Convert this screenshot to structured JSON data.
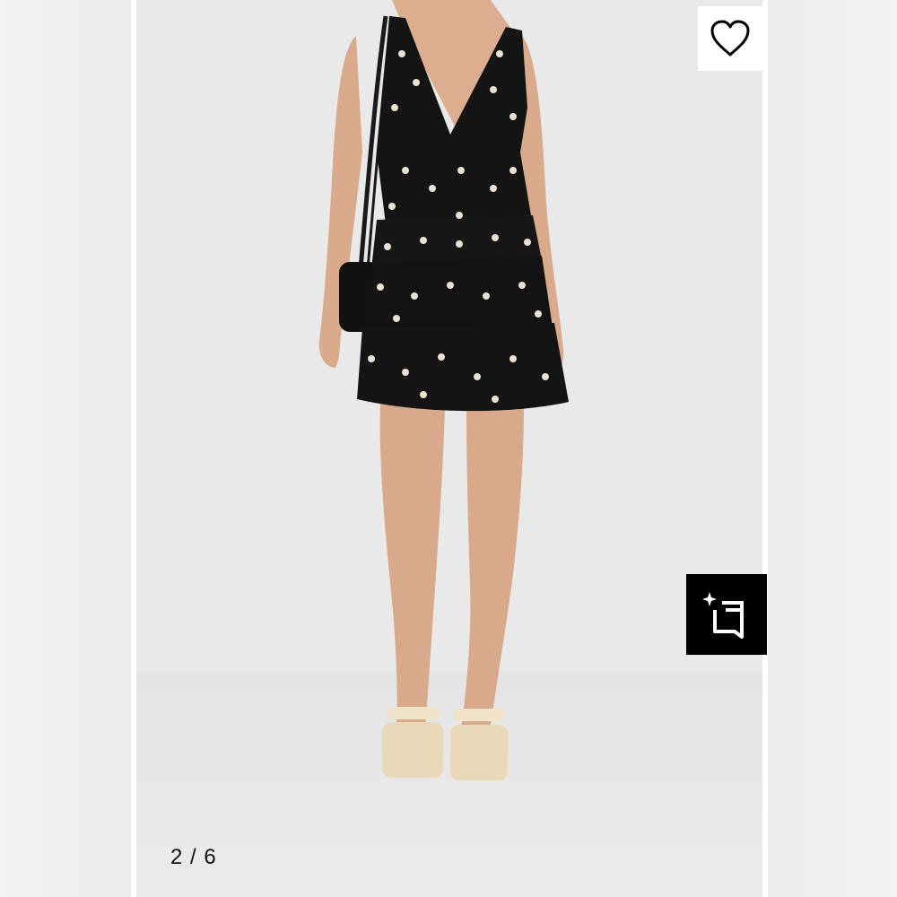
{
  "gallery": {
    "counter_text": "2 / 6",
    "current_index": 2,
    "total_images": 6
  },
  "icons": {
    "favorite": "heart-outline-icon",
    "save": "sparkle-square-icon"
  },
  "colors": {
    "page_background": "#ffffff",
    "photo_background": "#e9e9e9",
    "favorite_button_background": "#ffffff",
    "save_button_background": "#000000",
    "icon_dark": "#000000",
    "icon_light": "#ffffff"
  }
}
